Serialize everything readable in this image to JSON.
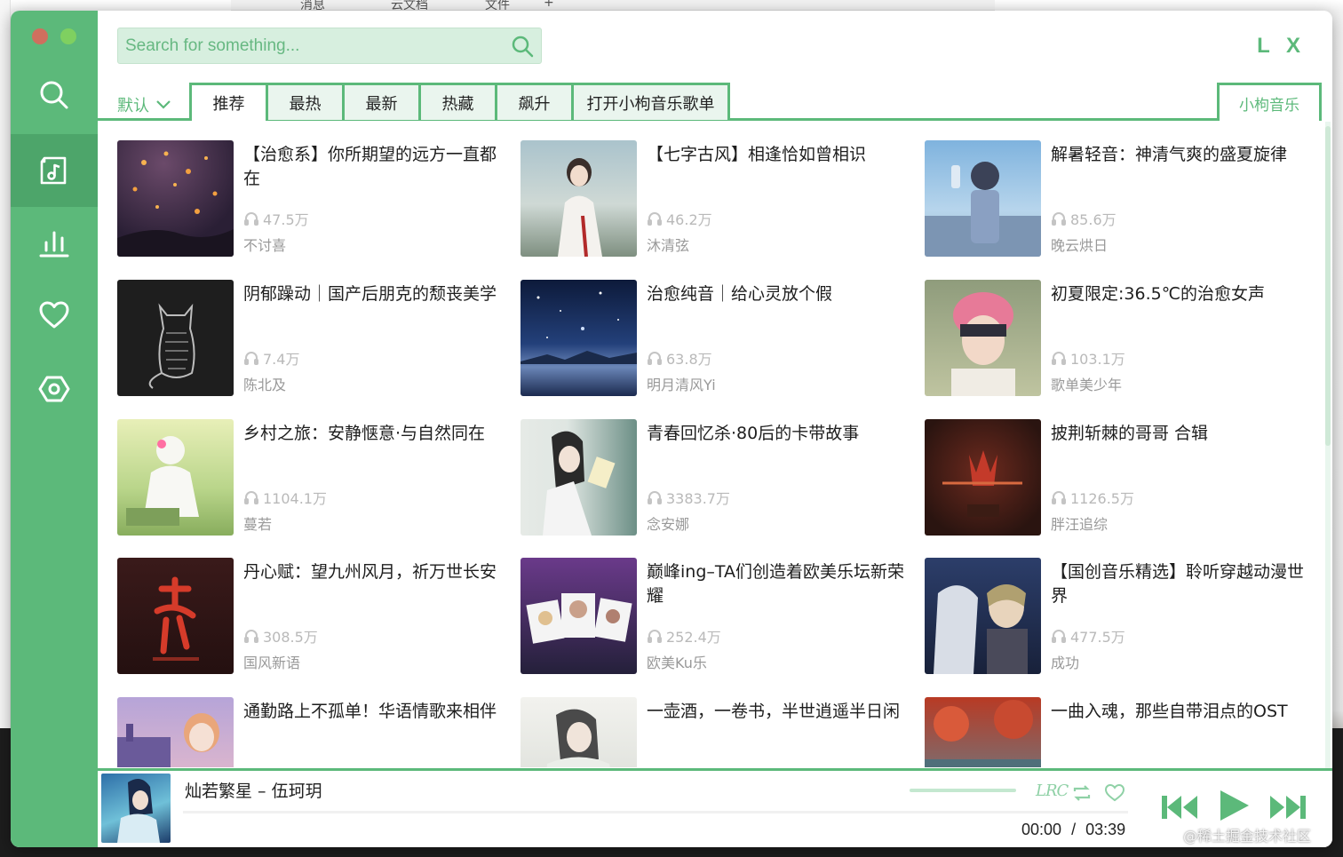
{
  "background": {
    "tabs": [
      {
        "label": "消息"
      },
      {
        "label": "云文档"
      },
      {
        "label": "文件"
      },
      {
        "label": "+"
      }
    ]
  },
  "sidebar": {
    "items": [
      {
        "icon": "search-icon"
      },
      {
        "icon": "music-note-icon",
        "active": true
      },
      {
        "icon": "chart-bars-icon"
      },
      {
        "icon": "heart-icon"
      },
      {
        "icon": "settings-icon"
      }
    ]
  },
  "header": {
    "search_placeholder": "Search for something...",
    "logo": "L X"
  },
  "tabs": {
    "default_label": "默认",
    "items": [
      "推荐",
      "最热",
      "最新",
      "热藏",
      "飙升",
      "打开小枸音乐歌单"
    ],
    "active_index": 0,
    "right_label": "小枸音乐"
  },
  "playlists": [
    {
      "title": "【治愈系】你所期望的远方一直都在",
      "plays": "47.5万",
      "author": "不讨喜"
    },
    {
      "title": "【七字古风】相逢恰如曾相识",
      "plays": "46.2万",
      "author": "沐清弦"
    },
    {
      "title": "解暑轻音：神清气爽的盛夏旋律",
      "plays": "85.6万",
      "author": "晚云烘日"
    },
    {
      "title": "阴郁躁动｜国产后朋克的颓丧美学",
      "plays": "7.4万",
      "author": "陈北及"
    },
    {
      "title": "治愈纯音｜给心灵放个假",
      "plays": "63.8万",
      "author": "明月清风Yi"
    },
    {
      "title": "初夏限定:36.5℃的治愈女声",
      "plays": "103.1万",
      "author": "歌单美少年"
    },
    {
      "title": "乡村之旅：安静惬意·与自然同在",
      "plays": "1104.1万",
      "author": "蔓若"
    },
    {
      "title": "青春回忆杀·80后的卡带故事",
      "plays": "3383.7万",
      "author": "念安娜"
    },
    {
      "title": "披荆斩棘的哥哥 合辑",
      "plays": "1126.5万",
      "author": "胖汪追综"
    },
    {
      "title": "丹心赋：望九州风月，祈万世长安",
      "plays": "308.5万",
      "author": "国风新语"
    },
    {
      "title": "巅峰ing–TA们创造着欧美乐坛新荣耀",
      "plays": "252.4万",
      "author": "欧美Ku乐"
    },
    {
      "title": "【国创音乐精选】聆听穿越动漫世界",
      "plays": "477.5万",
      "author": "成功"
    },
    {
      "title": "通勤路上不孤单！华语情歌来相伴",
      "plays": "",
      "author": ""
    },
    {
      "title": "一壶酒，一卷书，半世逍遥半日闲",
      "plays": "",
      "author": ""
    },
    {
      "title": "一曲入魂，那些自带泪点的OST",
      "plays": "",
      "author": ""
    }
  ],
  "player": {
    "song": "灿若繁星 – 伍珂玥",
    "lrc_label": "LRC",
    "current_time": "00:00",
    "separator": "/",
    "duration": "03:39",
    "progress": 0
  },
  "watermark": "@稀土掘金技术社区",
  "colors": {
    "accent": "#5cb97a",
    "accent_dark": "#4da56a",
    "search_bg": "#d7efdf"
  }
}
